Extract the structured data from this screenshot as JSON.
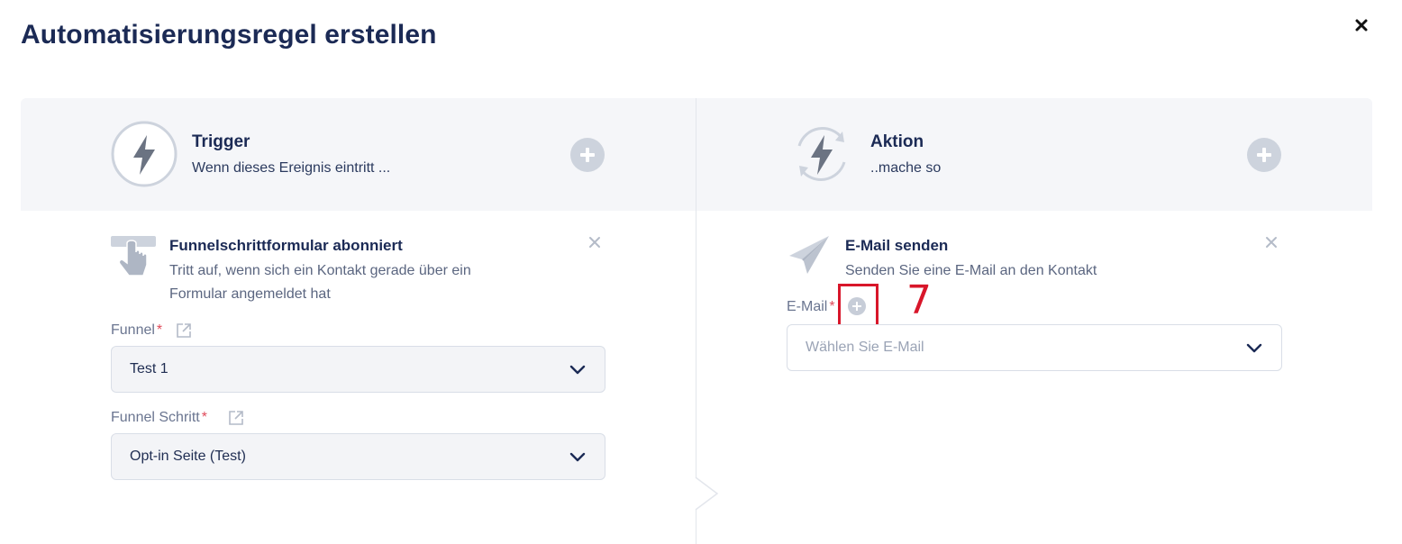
{
  "dialog": {
    "title": "Automatisierungsregel erstellen",
    "close_icon": "close-icon"
  },
  "trigger": {
    "title": "Trigger",
    "subtitle": "Wenn dieses Ereignis eintritt ...",
    "icon": "lightning-icon",
    "add_icon": "plus-circle-icon",
    "card": {
      "icon": "hand-pointer-icon",
      "title": "Funnelschrittformular abonniert",
      "description_line1": "Tritt auf, wenn sich ein Kontakt gerade über ein",
      "description_line2": "Formular angemeldet hat"
    },
    "fields": {
      "funnel": {
        "label": "Funnel",
        "required_mark": "*",
        "value": "Test 1"
      },
      "funnel_step": {
        "label": "Funnel Schritt",
        "required_mark": "*",
        "value": "Opt-in Seite (Test)"
      }
    }
  },
  "action": {
    "title": "Aktion",
    "subtitle": "..mache so",
    "icon": "lightning-cycle-icon",
    "add_icon": "plus-circle-icon",
    "card": {
      "icon": "paper-plane-icon",
      "title": "E-Mail senden",
      "description": "Senden Sie eine E-Mail an den Kontakt"
    },
    "fields": {
      "email": {
        "label": "E-Mail",
        "required_mark": "*",
        "placeholder": "Wählen Sie E-Mail"
      }
    }
  },
  "annotation": {
    "marker": "7",
    "color": "#d8162a"
  },
  "colors": {
    "primary_text": "#1b2a55",
    "required": "#e04a5a",
    "header_bg": "#f5f6f9",
    "icon_gray": "#cdd3dd"
  }
}
